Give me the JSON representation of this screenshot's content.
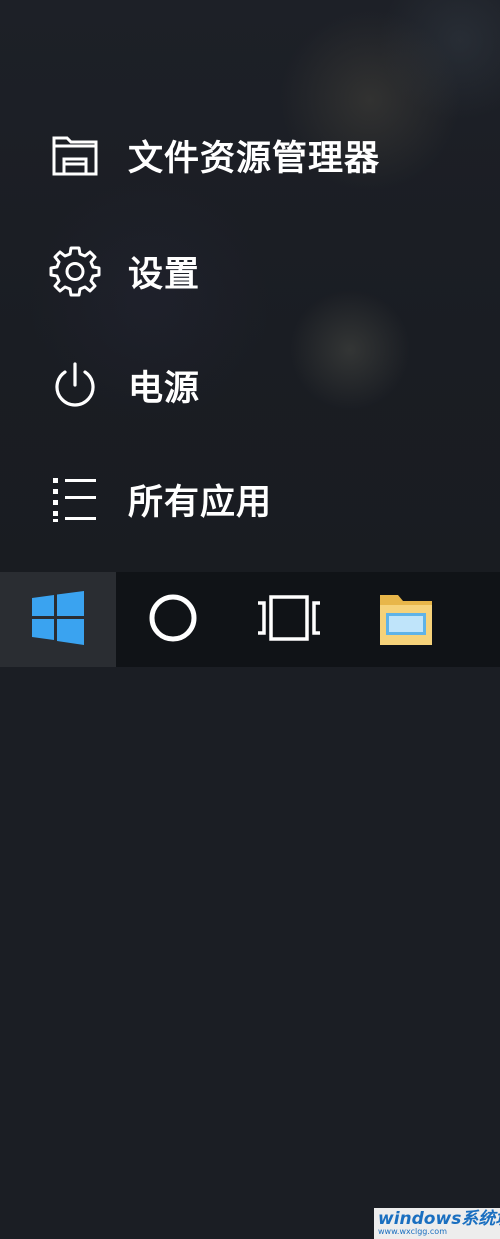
{
  "start_menu": {
    "items": [
      {
        "label": "文件资源管理器",
        "icon": "file-explorer-icon"
      },
      {
        "label": "设置",
        "icon": "gear-icon"
      },
      {
        "label": "电源",
        "icon": "power-icon"
      },
      {
        "label": "所有应用",
        "icon": "all-apps-list-icon"
      }
    ]
  },
  "taskbar": {
    "buttons": [
      {
        "icon": "windows-logo-icon"
      },
      {
        "icon": "cortana-circle-icon"
      },
      {
        "icon": "task-view-icon"
      },
      {
        "icon": "folder-icon"
      }
    ]
  },
  "watermark": {
    "title": "windows系统城",
    "url": "www.wxclgg.com"
  },
  "colors": {
    "windows_blue": "#3aa3f0",
    "taskbar": "#101317",
    "start_button_highlight": "#2a2d32",
    "menu_text": "#ffffff"
  }
}
